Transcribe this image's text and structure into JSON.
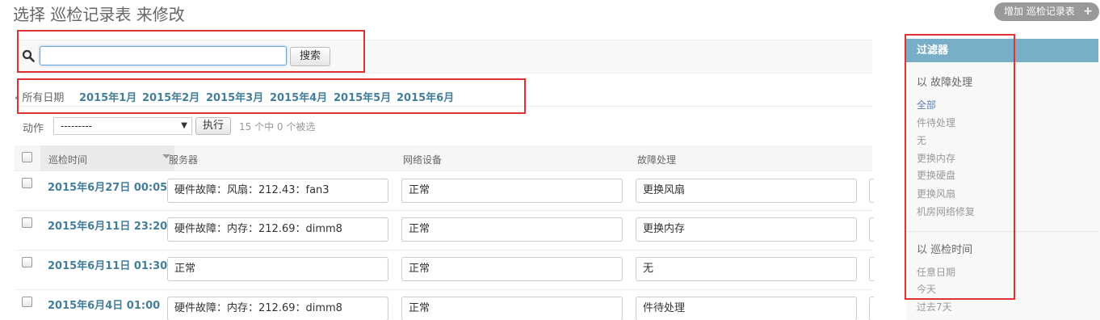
{
  "page": {
    "title": "选择 巡检记录表 来修改"
  },
  "add_button": {
    "label": "增加 巡检记录表",
    "icon": "plus-icon"
  },
  "search": {
    "value": "",
    "placeholder": "",
    "button_label": "搜索",
    "icon": "search-icon"
  },
  "date_hierarchy": {
    "items": [
      "‹ 所有日期",
      "2015年1月",
      "2015年2月",
      "2015年3月",
      "2015年4月",
      "2015年5月",
      "2015年6月"
    ]
  },
  "actions": {
    "label": "动作",
    "select_value": "---------",
    "go_label": "执行",
    "counter": "15 个中 0 个被选"
  },
  "table": {
    "columns": [
      "巡检时间",
      "服务器",
      "网络设备",
      "故障处理"
    ],
    "rows": [
      {
        "time": "2015年6月27日 00:05",
        "server": "硬件故障：风扇：212.43：fan3",
        "network": "正常",
        "handling": "更换风扇"
      },
      {
        "time": "2015年6月11日 23:20",
        "server": "硬件故障：内存：212.69：dimm8",
        "network": "正常",
        "handling": "更换内存"
      },
      {
        "time": "2015年6月11日 01:30",
        "server": "正常",
        "network": "正常",
        "handling": "无"
      },
      {
        "time": "2015年6月4日 01:00",
        "server": "硬件故障：内存：212.69：dimm8",
        "network": "正常",
        "handling": "件待处理"
      }
    ]
  },
  "filter": {
    "title": "过滤器",
    "groups": [
      {
        "label": "以 故障处理",
        "options": [
          "全部",
          "件待处理",
          "无",
          "更换内存",
          "更换硬盘",
          "更换风扇",
          "机房网络修复"
        ]
      },
      {
        "label": "以 巡检时间",
        "options": [
          "任意日期",
          "今天",
          "过去7天"
        ]
      }
    ]
  },
  "colors": {
    "link": "#447e9b",
    "filter_header": "#79aec8",
    "annotation_red": "#dd3333"
  }
}
